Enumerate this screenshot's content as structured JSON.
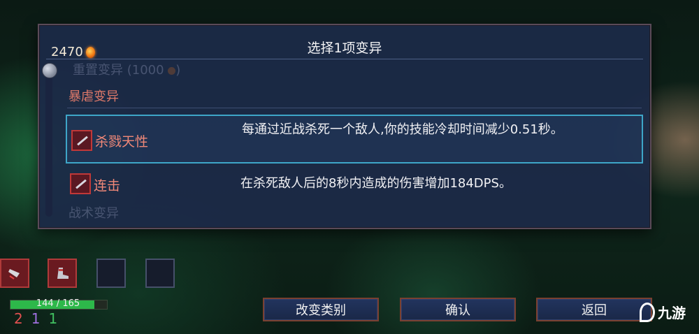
{
  "header": {
    "cells_count": "2470",
    "title": "选择1项变异"
  },
  "list": {
    "reroll_label": "重置变异 (1000",
    "category_brutality": "暴虐变异",
    "category_tactics": "战术变异",
    "mutations": [
      {
        "name": "杀戮天性",
        "desc": "每通过近战杀死一个敌人,你的技能冷却时间减少0.51秒。",
        "selected": true,
        "icon": "blade-icon"
      },
      {
        "name": "连击",
        "desc": "在杀死敌人后的8秒内造成的伤害增加184DPS。",
        "selected": false,
        "icon": "combo-blade-icon"
      }
    ]
  },
  "hud": {
    "hp_text": "144 / 165",
    "hp_fraction": 0.873,
    "scroll_counts": [
      "2",
      "1",
      "1"
    ],
    "scroll_colors": [
      "#e05050",
      "#a070e0",
      "#40c060"
    ]
  },
  "buttons": {
    "change_category": "改变类别",
    "confirm": "确认",
    "back": "返回"
  },
  "watermark": "九游"
}
